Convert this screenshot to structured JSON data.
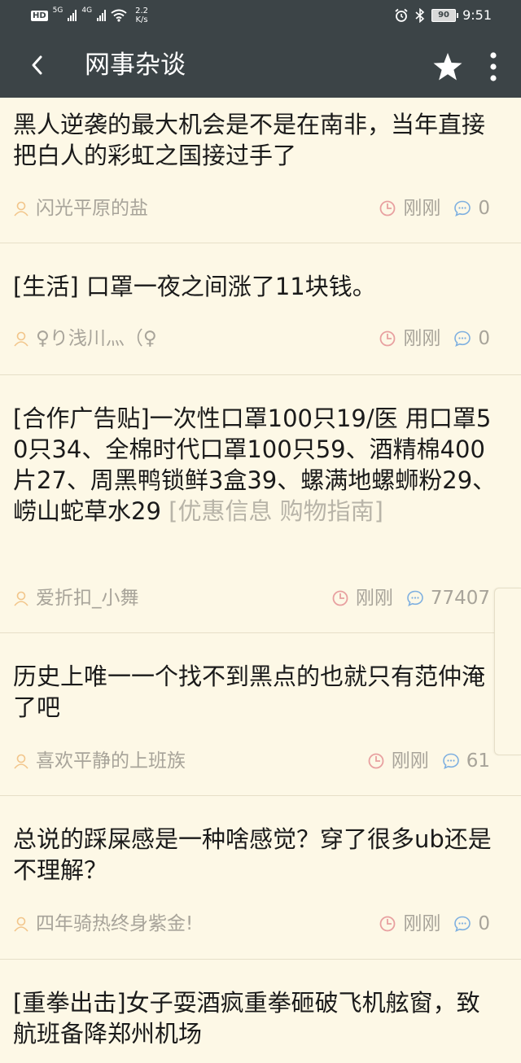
{
  "status_bar": {
    "hd": "HD",
    "net1": "5G",
    "net2": "4G",
    "speed_value": "2.2",
    "speed_unit": "K/s",
    "battery": "90",
    "time": "9:51"
  },
  "toolbar": {
    "title": "网事杂谈"
  },
  "posts": [
    {
      "title": "黑人逆袭的最大机会是不是在南非，当年直接把白人的彩虹之国接过手了",
      "tag": "",
      "author": "闪光平原的盐",
      "time": "刚刚",
      "replies": "0"
    },
    {
      "title": "[生活] 口罩一夜之间涨了11块钱。",
      "tag": "",
      "author": "♀り浅川灬（♀",
      "time": "刚刚",
      "replies": "0"
    },
    {
      "title": "[合作广告贴]一次性口罩100只19/医 用口罩50只34、全棉时代口罩100只59、酒精棉400片27、周黑鸭锁鲜3盒39、螺满地螺蛳粉29、崂山蛇草水29 ",
      "tag": "[优惠信息 购物指南]",
      "author": "爱折扣_小舞",
      "time": "刚刚",
      "replies": "77407"
    },
    {
      "title": "历史上唯一一个找不到黑点的也就只有范仲淹了吧",
      "tag": "",
      "author": "喜欢平静的上班族",
      "time": "刚刚",
      "replies": "61"
    },
    {
      "title": "总说的踩屎感是一种啥感觉？穿了很多ub还是不理解？",
      "tag": "",
      "author": "四年骑热终身紫金!",
      "time": "刚刚",
      "replies": "0"
    },
    {
      "title": "[重拳出击]女子耍酒疯重拳砸破飞机舷窗，致航班备降郑州机场",
      "tag": "",
      "author": "",
      "time": "",
      "replies": ""
    }
  ],
  "colors": {
    "header_bg": "#3c4447",
    "page_bg": "#fdf8e6",
    "title_text": "#1a1a1a",
    "meta_text": "#a8a49a",
    "author_icon": "#f2c58a",
    "time_icon": "#e8a0a0",
    "reply_icon": "#7fb0e0"
  }
}
